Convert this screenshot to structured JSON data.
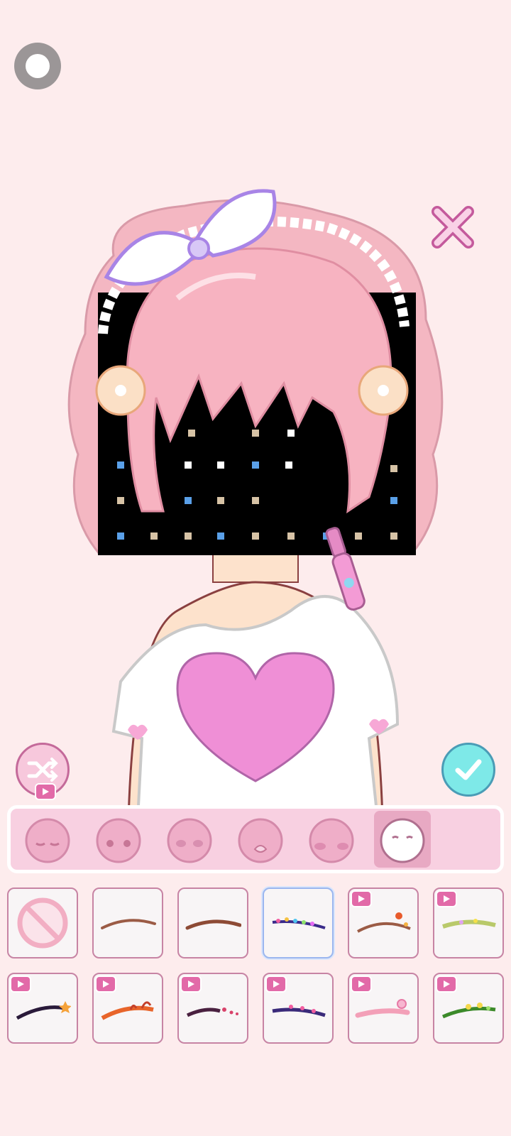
{
  "app": {
    "screen": "makeup-eyebrow-editor"
  },
  "colors": {
    "background": "#fdeced",
    "accent_pink": "#f8d0e1",
    "accent_border": "#c784a4",
    "confirm": "#7ee9e8",
    "hair": "#f5b6c4",
    "bow": "#c9b5f0"
  },
  "top": {
    "record_icon": "record-circle-icon",
    "close_icon": "close-x-icon"
  },
  "actions": {
    "shuffle_icon": "shuffle-icon",
    "shuffle_badge": "video-ad-icon",
    "confirm_icon": "checkmark-icon"
  },
  "categories": [
    {
      "name": "eyes-closed",
      "icon": "face-eyes-closed-icon",
      "active": false
    },
    {
      "name": "eyes-dots",
      "icon": "face-dot-eyes-icon",
      "active": false
    },
    {
      "name": "eyelids",
      "icon": "face-eyelids-icon",
      "active": false
    },
    {
      "name": "mouth",
      "icon": "face-mouth-icon",
      "active": false
    },
    {
      "name": "blush",
      "icon": "face-blush-icon",
      "active": false
    },
    {
      "name": "eyebrows",
      "icon": "face-eyebrows-icon",
      "active": true
    }
  ],
  "eyebrow_options": [
    {
      "id": "none",
      "icon": "no-symbol-icon",
      "ad": false,
      "selected": false
    },
    {
      "id": "brow-brown-thin",
      "icon": "eyebrow-brown-icon",
      "ad": false,
      "selected": false
    },
    {
      "id": "brow-brown-medium",
      "icon": "eyebrow-brown-icon",
      "ad": false,
      "selected": false
    },
    {
      "id": "brow-rainbow",
      "icon": "eyebrow-rainbow-icon",
      "ad": false,
      "selected": true
    },
    {
      "id": "brow-flower-brown",
      "icon": "eyebrow-flower-icon",
      "ad": true,
      "selected": false
    },
    {
      "id": "brow-green-floral",
      "icon": "eyebrow-floral-icon",
      "ad": true,
      "selected": false
    },
    {
      "id": "brow-black-star",
      "icon": "eyebrow-star-icon",
      "ad": true,
      "selected": false
    },
    {
      "id": "brow-orange-flame",
      "icon": "eyebrow-flame-icon",
      "ad": true,
      "selected": false
    },
    {
      "id": "brow-hearts",
      "icon": "eyebrow-hearts-icon",
      "ad": true,
      "selected": false
    },
    {
      "id": "brow-purple-dots",
      "icon": "eyebrow-dots-icon",
      "ad": true,
      "selected": false
    },
    {
      "id": "brow-pink-flower",
      "icon": "eyebrow-pink-flower-icon",
      "ad": true,
      "selected": false
    },
    {
      "id": "brow-vine",
      "icon": "eyebrow-vine-icon",
      "ad": true,
      "selected": false
    }
  ]
}
